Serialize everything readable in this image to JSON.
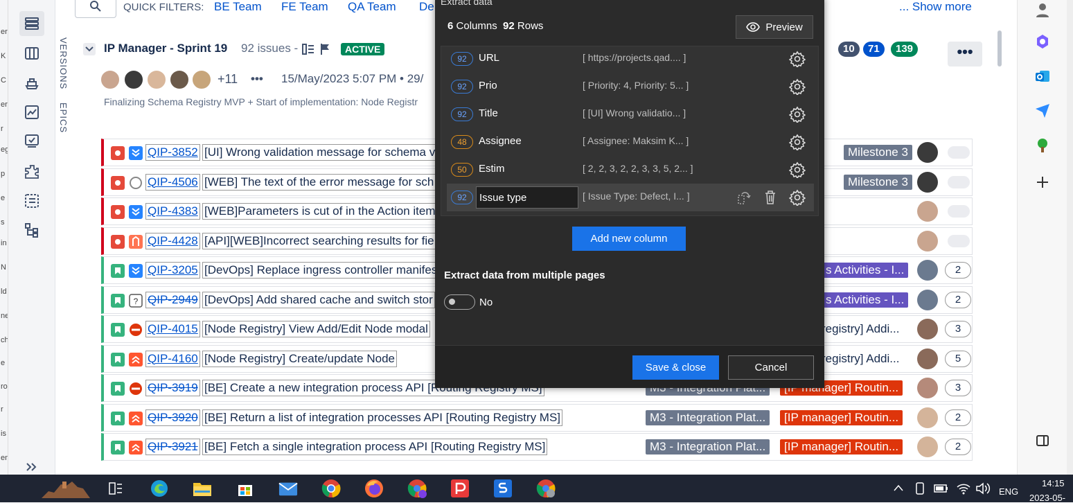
{
  "filters": {
    "label": "QUICK FILTERS:",
    "items": [
      "BE Team",
      "FE Team",
      "QA Team",
      "De"
    ],
    "show_more": "... Show more"
  },
  "side_tabs": {
    "versions": "VERSIONS",
    "epics": "EPICS"
  },
  "sprint": {
    "title": "IP Manager - Sprint 19",
    "issues": "92 issues -",
    "status": "ACTIVE",
    "avatars_more": "+11",
    "date": "15/May/2023 5:07 PM • 29/",
    "goal": "Finalizing Schema Registry MVP + Start of implementation: Node Registr",
    "counts": [
      "10",
      "71",
      "139"
    ],
    "more_label": "•••"
  },
  "issues": [
    {
      "key": "QIP-3852",
      "summary": "[UI] Wrong validation message for schema v",
      "done": false,
      "epic": "",
      "label": "",
      "milestone": "Milestone 3",
      "count": ""
    },
    {
      "key": "QIP-4506",
      "summary": "[WEB] The text of the error message for sch",
      "done": false,
      "epic": "",
      "label": "",
      "milestone": "Milestone 3",
      "count": ""
    },
    {
      "key": "QIP-4383",
      "summary": "[WEB]Parameters is cut of in the Action item",
      "done": false,
      "epic": "",
      "label": "",
      "milestone": "",
      "count": ""
    },
    {
      "key": "QIP-4428",
      "summary": "[API][WEB]Incorrect searching results for fie",
      "done": false,
      "epic": "",
      "label": "",
      "milestone": "",
      "count": ""
    },
    {
      "key": "QIP-3205",
      "summary": "[DevOps] Replace ingress controller manifes",
      "done": false,
      "epic": "",
      "label": "s Activities - I...",
      "milestone": "",
      "count": "2"
    },
    {
      "key": "QIP-2949",
      "summary": "[DevOps] Add shared cache and switch stor",
      "done": true,
      "epic": "",
      "label": "s Activities - I...",
      "milestone": "",
      "count": "2"
    },
    {
      "key": "QIP-4015",
      "summary": "[Node Registry] View Add/Edit Node modal",
      "done": false,
      "epic": "",
      "label": "registry] Addi...",
      "milestone": "",
      "count": "3"
    },
    {
      "key": "QIP-4160",
      "summary": "[Node Registry] Create/update Node",
      "done": false,
      "epic": "",
      "label": "registry] Addi...",
      "milestone": "",
      "count": "5"
    },
    {
      "key": "QIP-3919",
      "summary": "[BE] Create a new integration process API [Routing Registry MS]",
      "done": true,
      "epic": "M3 - Integration Plat...",
      "label": "[IP manager] Routin...",
      "milestone": "",
      "count": "3"
    },
    {
      "key": "QIP-3920",
      "summary": "[BE] Return a list of integration processes API [Routing Registry MS]",
      "done": true,
      "epic": "M3 - Integration Plat...",
      "label": "[IP manager] Routin...",
      "milestone": "",
      "count": "2"
    },
    {
      "key": "QIP-3921",
      "summary": "[BE] Fetch a single integration process API [Routing Registry MS]",
      "done": true,
      "epic": "M3 - Integration Plat...",
      "label": "[IP manager] Routin...",
      "milestone": "",
      "count": "2"
    }
  ],
  "dialog": {
    "title": "Extract data",
    "columns_count": "6",
    "columns_word": "Columns",
    "rows_count": "92",
    "rows_word": "Rows",
    "preview_label": "Preview",
    "columns": [
      {
        "count": "92",
        "name": "URL",
        "preview": "[ https://projects.qad.... ]",
        "color": "blue"
      },
      {
        "count": "92",
        "name": "Prio",
        "preview": "[ Priority: 4, Priority: 5... ]",
        "color": "blue"
      },
      {
        "count": "92",
        "name": "Title",
        "preview": "[ [UI] Wrong validatio... ]",
        "color": "blue"
      },
      {
        "count": "48",
        "name": "Assignee",
        "preview": "[ Assignee: Maksim K... ]",
        "color": "orange"
      },
      {
        "count": "50",
        "name": "Estim",
        "preview": "[ 2, 2, 3, 2, 2, 3, 3, 5, 2... ]",
        "color": "orange"
      }
    ],
    "editing": {
      "count": "92",
      "value": "Issue type",
      "preview": "[ Issue Type: Defect, I... ]"
    },
    "add_column": "Add new column",
    "multi_pages_label": "Extract data from multiple pages",
    "multi_pages_value": "No",
    "save": "Save & close",
    "cancel": "Cancel"
  },
  "taskbar": {
    "lang": "ENG",
    "time": "14:15",
    "date": "2023-05-"
  },
  "colors": {
    "blue": "#0052cc",
    "active": "#00875a",
    "epic": "#6b778c",
    "label": "#de350b",
    "purple": "#6554c0",
    "accent": "#1a73e8"
  }
}
